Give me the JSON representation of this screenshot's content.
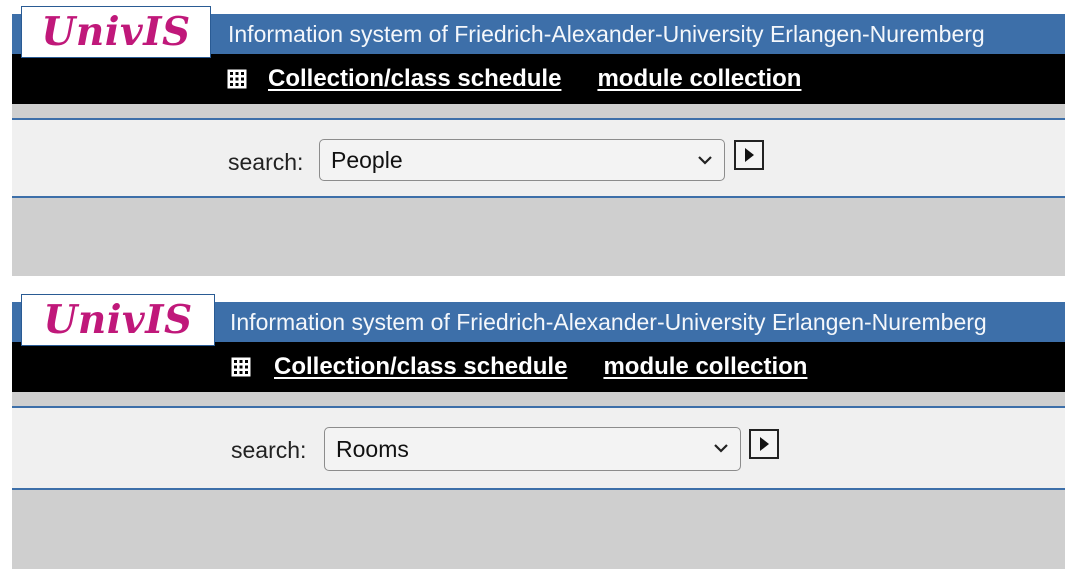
{
  "panels": [
    {
      "logo_text": "UnivIS",
      "title": "Information system of Friedrich-Alexander-University Erlangen-Nuremberg",
      "nav": {
        "icon": "grid-calendar-icon",
        "links": [
          "Collection/class schedule",
          "module collection"
        ]
      },
      "search": {
        "label": "search:",
        "selected": "People",
        "go_icon": "play-arrow-icon"
      }
    },
    {
      "logo_text": "UnivIS",
      "title": "Information system of Friedrich-Alexander-University Erlangen-Nuremberg",
      "nav": {
        "icon": "grid-calendar-icon",
        "links": [
          "Collection/class schedule",
          "module collection"
        ]
      },
      "search": {
        "label": "search:",
        "selected": "Rooms",
        "go_icon": "play-arrow-icon"
      }
    }
  ],
  "colors": {
    "brand_magenta": "#c0187a",
    "header_blue": "#3d6fa9",
    "nav_black": "#000000",
    "panel_gray": "#cfcfcf",
    "search_bg": "#f0f0f0"
  }
}
